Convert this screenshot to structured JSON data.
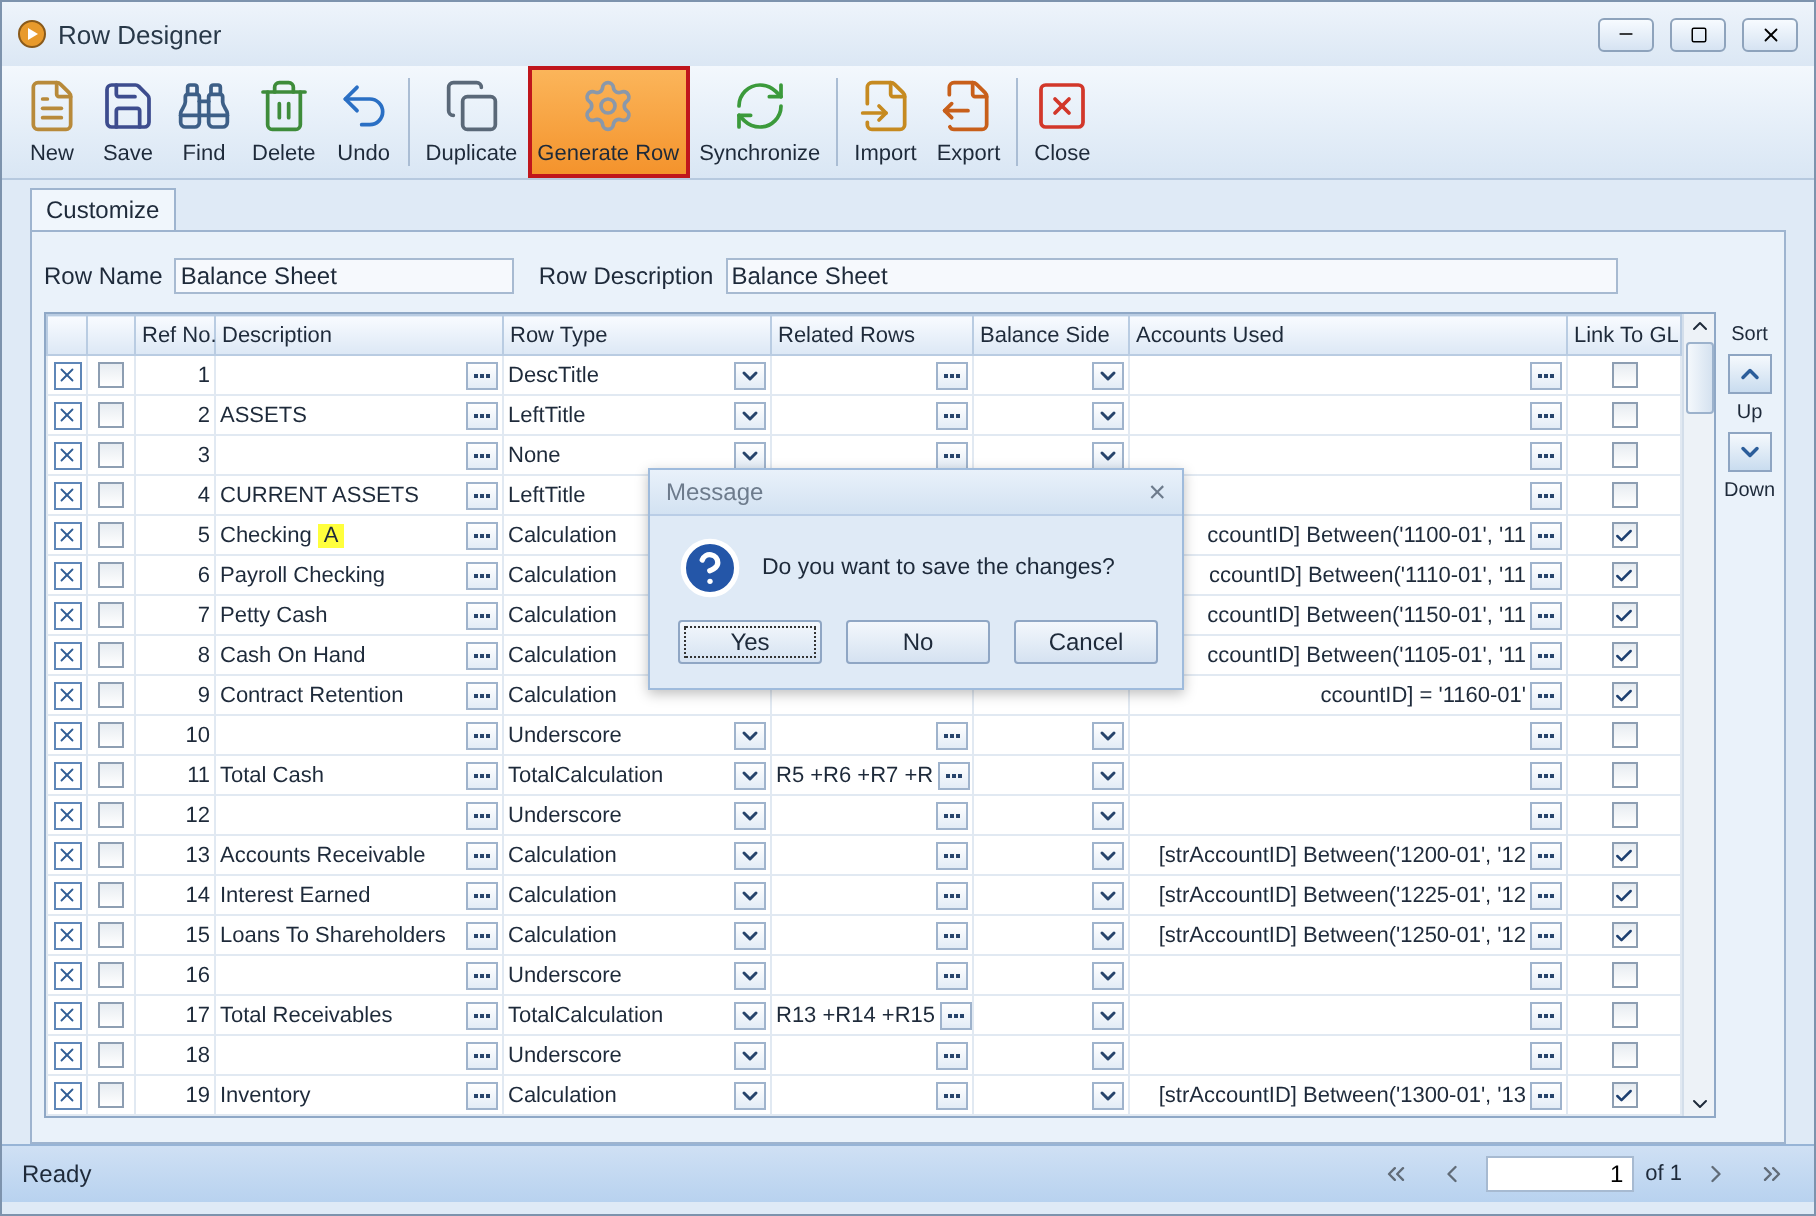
{
  "window": {
    "title": "Row Designer"
  },
  "toolbar": [
    [
      {
        "label": "New",
        "selected": false
      },
      {
        "label": "Save",
        "selected": false
      },
      {
        "label": "Find",
        "selected": false
      },
      {
        "label": "Delete",
        "selected": false
      },
      {
        "label": "Undo",
        "selected": false
      }
    ],
    [
      {
        "label": "Duplicate",
        "selected": false
      },
      {
        "label": "Generate Row",
        "selected": true
      },
      {
        "label": "Synchronize",
        "selected": false
      }
    ],
    [
      {
        "label": "Import",
        "selected": false
      },
      {
        "label": "Export",
        "selected": false
      }
    ],
    [
      {
        "label": "Close",
        "selected": false
      }
    ]
  ],
  "tabs": [
    {
      "label": "Customize",
      "selected": true
    }
  ],
  "fields": [
    {
      "label": "Row Name",
      "value": "Balance Sheet"
    },
    {
      "label": "Row Description",
      "value": "Balance Sheet"
    }
  ],
  "table": {
    "columns": [
      "Ref No.",
      "Description",
      "Row Type",
      "Related Rows",
      "Balance Side",
      "Accounts Used",
      "Link To GL"
    ],
    "rows": [
      {
        "ref": "1",
        "row_type": "DescTitle",
        "checked": false,
        "link_to_gl": false
      },
      {
        "ref": "2",
        "description": "ASSETS",
        "row_type": "LeftTitle",
        "checked": false,
        "link_to_gl": false
      },
      {
        "ref": "3",
        "row_type": "None",
        "checked": false,
        "link_to_gl": false
      },
      {
        "ref": "4",
        "description": "CURRENT ASSETS",
        "row_type": "LeftTitle",
        "checked": false,
        "link_to_gl": false
      },
      {
        "ref": "5",
        "description": "Checking",
        "highlight": "A",
        "row_type": "Calculation",
        "accounts_used": "ccountID] Between('1100-01', '11",
        "checked": false,
        "link_to_gl": true
      },
      {
        "ref": "6",
        "description": "Payroll Checking",
        "row_type": "Calculation",
        "accounts_used": "ccountID] Between('1110-01', '11",
        "checked": false,
        "link_to_gl": true
      },
      {
        "ref": "7",
        "description": "Petty Cash",
        "row_type": "Calculation",
        "accounts_used": "ccountID] Between('1150-01', '11",
        "checked": false,
        "link_to_gl": true
      },
      {
        "ref": "8",
        "description": "Cash On Hand",
        "row_type": "Calculation",
        "accounts_used": "ccountID] Between('1105-01', '11",
        "checked": false,
        "link_to_gl": true
      },
      {
        "ref": "9",
        "description": "Contract Retention",
        "row_type": "Calculation",
        "accounts_used": "ccountID] = '1160-01'",
        "checked": false,
        "link_to_gl": true
      },
      {
        "ref": "10",
        "row_type": "Underscore",
        "checked": false,
        "link_to_gl": false
      },
      {
        "ref": "11",
        "description": "Total Cash",
        "row_type": "TotalCalculation",
        "related_rows": "R5 +R6 +R7 +R",
        "checked": false,
        "link_to_gl": false
      },
      {
        "ref": "12",
        "row_type": "Underscore",
        "checked": false,
        "link_to_gl": false
      },
      {
        "ref": "13",
        "description": "Accounts Receivable",
        "row_type": "Calculation",
        "accounts_used": "[strAccountID] Between('1200-01', '12",
        "checked": false,
        "link_to_gl": true
      },
      {
        "ref": "14",
        "description": "Interest Earned",
        "row_type": "Calculation",
        "accounts_used": "[strAccountID] Between('1225-01', '12",
        "checked": false,
        "link_to_gl": true
      },
      {
        "ref": "15",
        "description": "Loans To Shareholders",
        "row_type": "Calculation",
        "accounts_used": "[strAccountID] Between('1250-01', '12",
        "checked": false,
        "link_to_gl": true
      },
      {
        "ref": "16",
        "row_type": "Underscore",
        "checked": false,
        "link_to_gl": false
      },
      {
        "ref": "17",
        "description": "Total Receivables",
        "row_type": "TotalCalculation",
        "related_rows": "R13 +R14 +R15",
        "checked": false,
        "link_to_gl": false
      },
      {
        "ref": "18",
        "row_type": "Underscore",
        "checked": false,
        "link_to_gl": false
      },
      {
        "ref": "19",
        "description": "Inventory",
        "row_type": "Calculation",
        "accounts_used": "[strAccountID] Between('1300-01', '13",
        "checked": false,
        "link_to_gl": true
      }
    ]
  },
  "sort": {
    "label": "Sort",
    "up": "Up",
    "down": "Down"
  },
  "dialog": {
    "title": "Message",
    "close": "×",
    "message": "Do you want to save the changes?",
    "buttons": [
      {
        "label": "Yes",
        "selected": true
      },
      {
        "label": "No",
        "selected": false
      },
      {
        "label": "Cancel",
        "selected": false
      }
    ]
  },
  "status_bar": {
    "text": "Ready",
    "page": "1",
    "of": "of 1"
  }
}
